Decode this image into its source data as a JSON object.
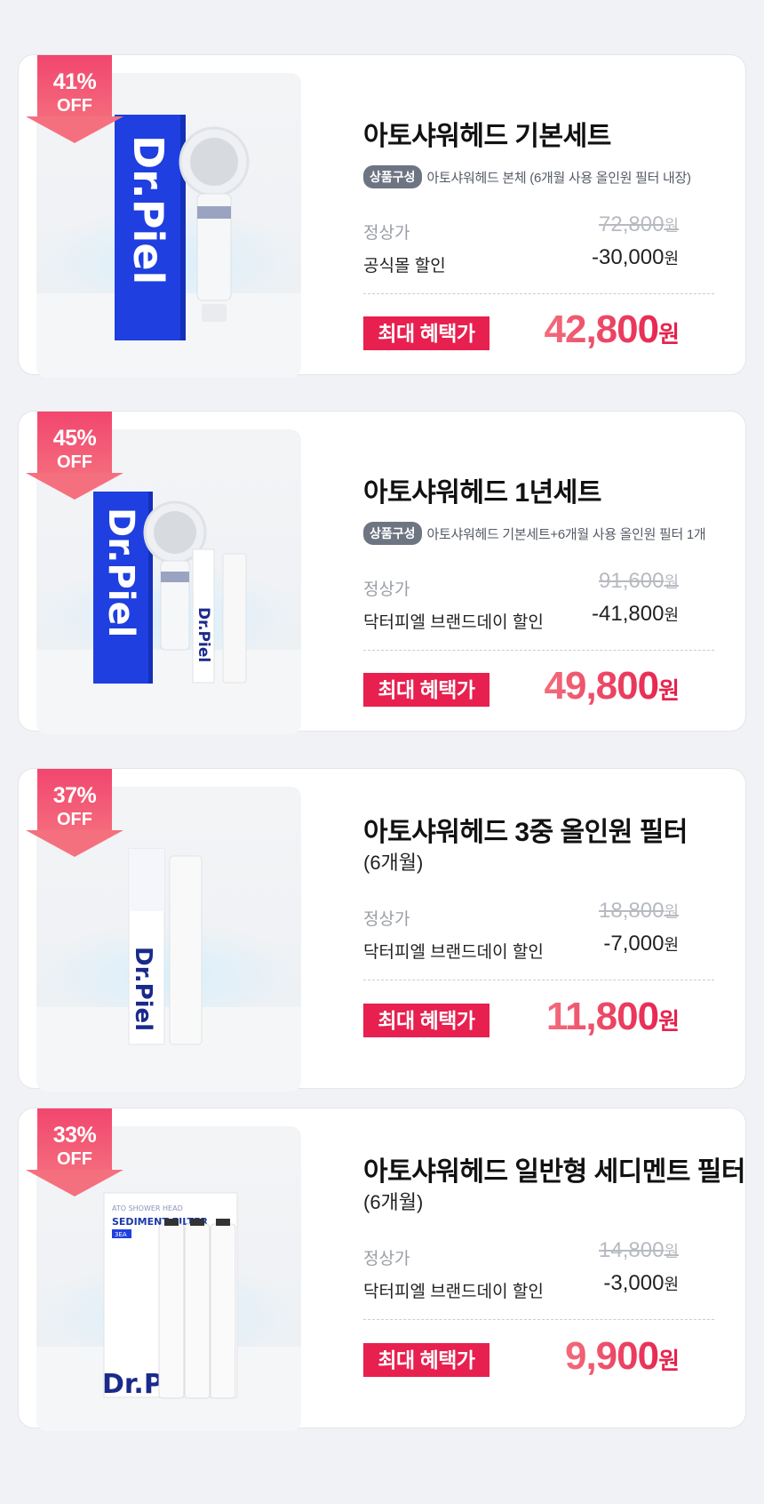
{
  "colors": {
    "accent": "#e7204f",
    "badge": "#f2466e",
    "tag": "#6d7582",
    "bg": "#f1f2f5"
  },
  "products": [
    {
      "badge_pct": "41%",
      "badge_off": "OFF",
      "title": "아토샤워헤드 기본세트",
      "subtitle": "",
      "comp_tag": "상품구성",
      "comp_desc": "아토샤워헤드 본체 (6개월 사용 올인원 필터 내장)",
      "regular_label": "정상가",
      "regular_price": "72,800",
      "won": "원",
      "discount_label": "공식몰 할인",
      "discount": "-30,000",
      "benefit_label": "최대 혜택가",
      "final_price": "42,800",
      "image_brand": "Dr.Piel"
    },
    {
      "badge_pct": "45%",
      "badge_off": "OFF",
      "title": "아토샤워헤드 1년세트",
      "subtitle": "",
      "comp_tag": "상품구성",
      "comp_desc": "아토샤워헤드 기본세트+6개월 사용 올인원 필터 1개",
      "regular_label": "정상가",
      "regular_price": "91,600",
      "won": "원",
      "discount_label": "닥터피엘 브랜드데이 할인",
      "discount": "-41,800",
      "benefit_label": "최대 혜택가",
      "final_price": "49,800",
      "image_brand": "Dr.Piel"
    },
    {
      "badge_pct": "37%",
      "badge_off": "OFF",
      "title": "아토샤워헤드 3중 올인원 필터",
      "subtitle": "(6개월)",
      "comp_tag": "",
      "comp_desc": "",
      "regular_label": "정상가",
      "regular_price": "18,800",
      "won": "원",
      "discount_label": "닥터피엘 브랜드데이 할인",
      "discount": "-7,000",
      "benefit_label": "최대 혜택가",
      "final_price": "11,800",
      "image_brand": "Dr.Piel"
    },
    {
      "badge_pct": "33%",
      "badge_off": "OFF",
      "title": "아토샤워헤드 일반형 세디멘트 필터",
      "subtitle": "(6개월)",
      "comp_tag": "",
      "comp_desc": "",
      "regular_label": "정상가",
      "regular_price": "14,800",
      "won": "원",
      "discount_label": "닥터피엘 브랜드데이 할인",
      "discount": "-3,000",
      "benefit_label": "최대 혜택가",
      "final_price": "9,900",
      "image_brand": "Dr.Piel",
      "image_box_small": "ATO SHOWER HEAD",
      "image_box_title": "SEDIMENT FILTER",
      "image_box_qty": "3EA"
    }
  ]
}
